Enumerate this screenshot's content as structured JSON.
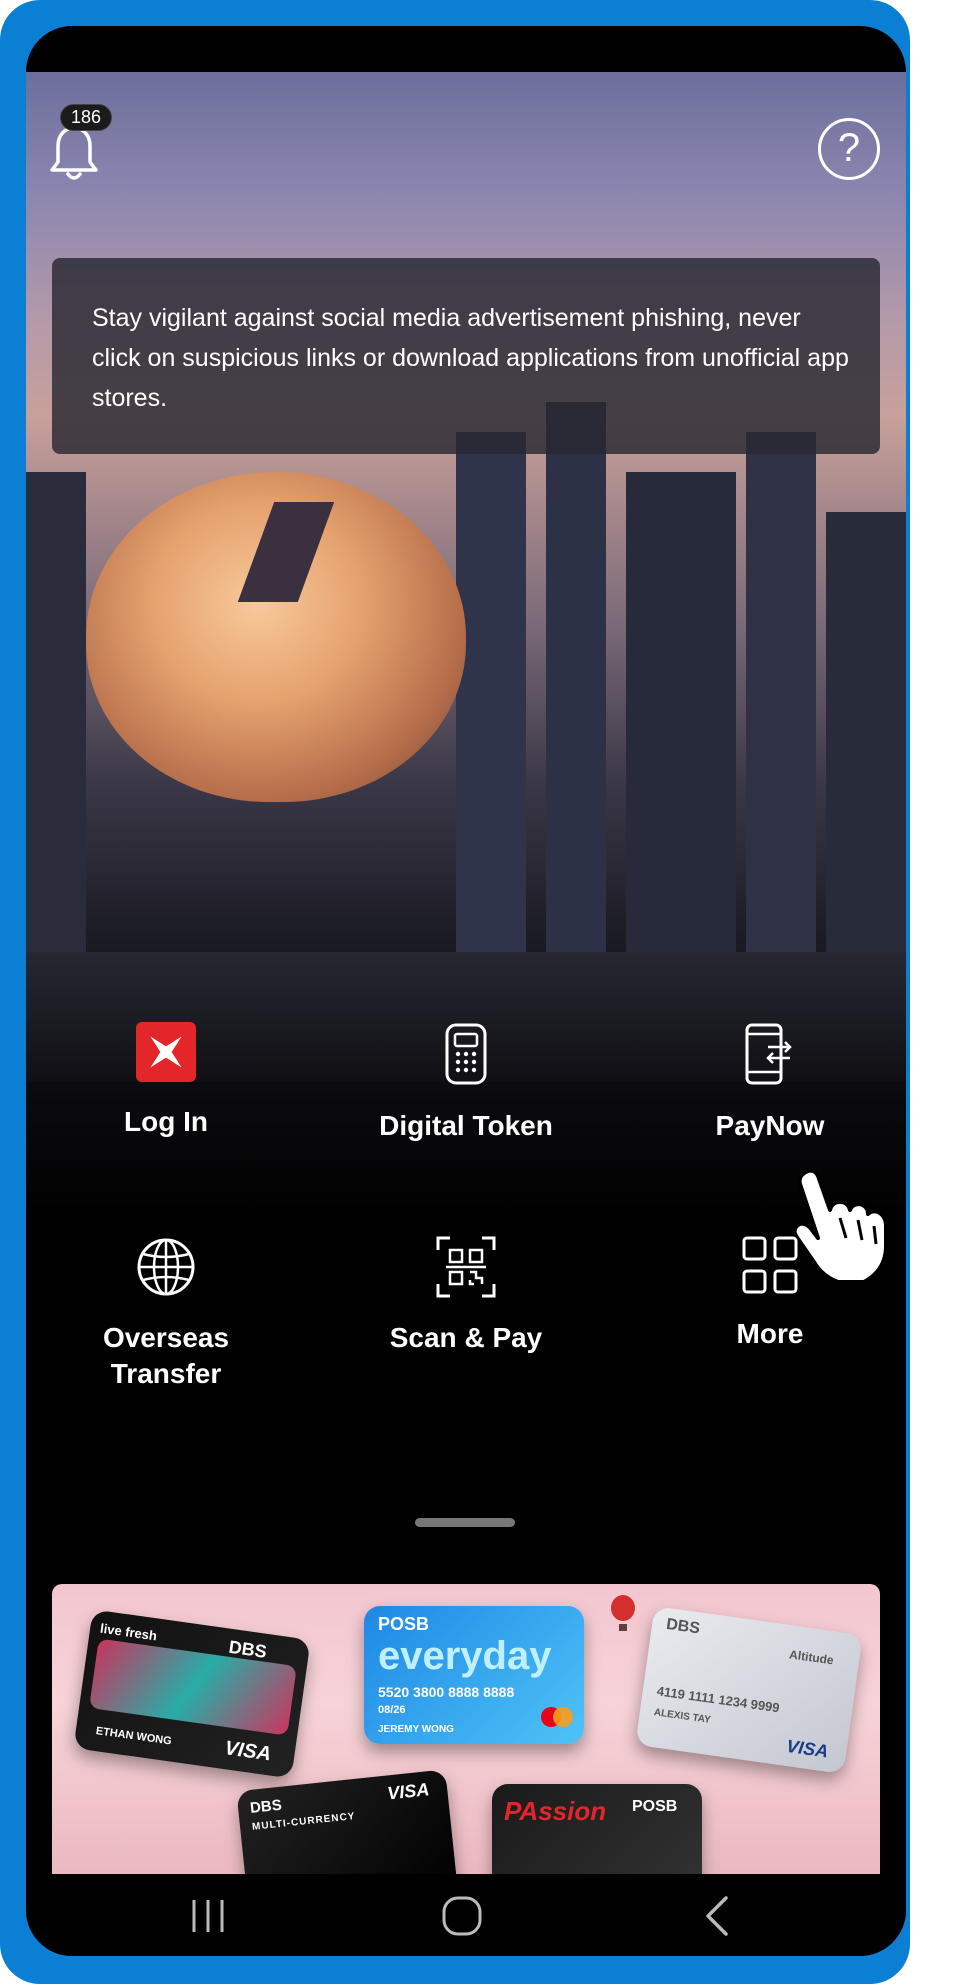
{
  "header": {
    "notification_count": "186",
    "help_symbol": "?"
  },
  "alert": {
    "message": "Stay vigilant against social media advertisement phishing, never click on suspicious links or download applications from unofficial app stores."
  },
  "actions": [
    {
      "label": "Log In",
      "icon": "dbs-logo-icon"
    },
    {
      "label": "Digital Token",
      "icon": "token-device-icon"
    },
    {
      "label": "PayNow",
      "icon": "phone-transfer-icon"
    },
    {
      "label": "Overseas\nTransfer",
      "icon": "globe-icon"
    },
    {
      "label": "Scan & Pay",
      "icon": "qr-scan-icon"
    },
    {
      "label": "More",
      "icon": "grid-icon"
    }
  ],
  "promo": {
    "cards": [
      {
        "brand": "DBS",
        "tag": "live fresh",
        "network": "VISA",
        "name": "ETHAN WONG"
      },
      {
        "brand": "POSB",
        "title": "everyday",
        "number": "5520 3800 8888 8888",
        "expiry": "08/26",
        "name": "JEREMY WONG"
      },
      {
        "brand": "DBS",
        "tag": "Altitude",
        "number": "4119 1111 1234 9999",
        "name": "ALEXIS TAY",
        "network": "VISA"
      },
      {
        "brand": "DBS",
        "tag": "MULTI-CURRENCY",
        "network": "VISA"
      },
      {
        "brand": "POSB",
        "title": "PAssion"
      }
    ]
  },
  "colors": {
    "frame_blue": "#0a7fd4",
    "dbs_red": "#e3262a"
  },
  "system_nav": {
    "recents": "recents-icon",
    "home": "home-icon",
    "back": "back-icon"
  }
}
